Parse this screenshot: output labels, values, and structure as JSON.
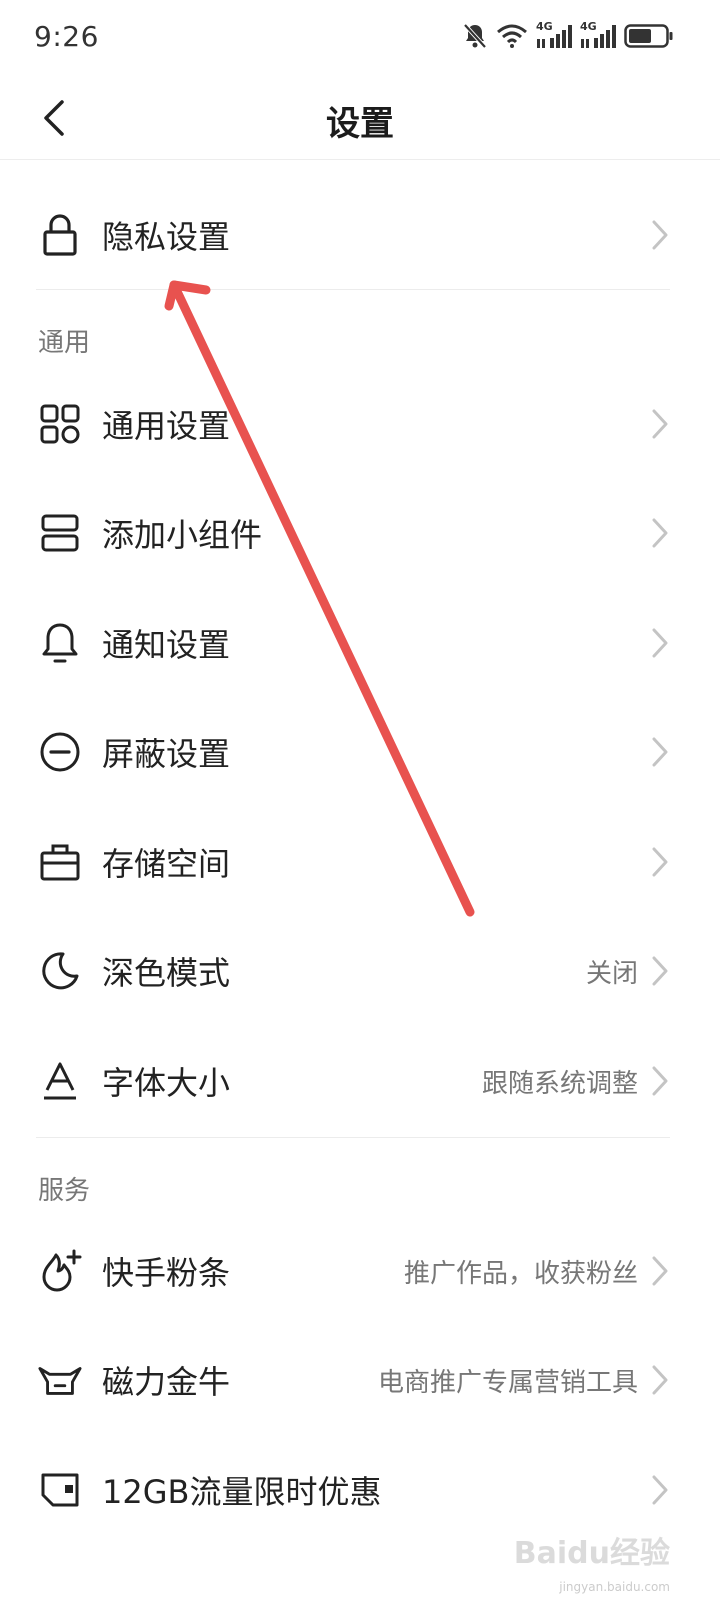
{
  "status_bar": {
    "time": "9:26",
    "net_label_1": "4G",
    "net_label_2": "4G"
  },
  "nav": {
    "title": "设置"
  },
  "privacy": {
    "label": "隐私设置",
    "icon": "lock-icon"
  },
  "general_section": {
    "header": "通用",
    "items": [
      {
        "label": "通用设置",
        "value": "",
        "icon": "grid-icon"
      },
      {
        "label": "添加小组件",
        "value": "",
        "icon": "widget-icon"
      },
      {
        "label": "通知设置",
        "value": "",
        "icon": "bell-icon"
      },
      {
        "label": "屏蔽设置",
        "value": "",
        "icon": "block-icon"
      },
      {
        "label": "存储空间",
        "value": "",
        "icon": "storage-box-icon"
      },
      {
        "label": "深色模式",
        "value": "关闭",
        "icon": "moon-icon"
      },
      {
        "label": "字体大小",
        "value": "跟随系统调整",
        "icon": "font-size-icon"
      }
    ]
  },
  "service_section": {
    "header": "服务",
    "items": [
      {
        "label": "快手粉条",
        "value": "推广作品，收获粉丝",
        "icon": "flame-plus-icon"
      },
      {
        "label": "磁力金牛",
        "value": "电商推广专属营销工具",
        "icon": "bull-icon"
      },
      {
        "label": "12GB流量限时优惠",
        "value": "",
        "icon": "sim-card-icon"
      }
    ]
  },
  "watermark": {
    "logo": "Baidu经验",
    "sub": "jingyan.baidu.com"
  },
  "colors": {
    "annotation_arrow": "#e8524f",
    "chevron": "#c4c4c4",
    "divider": "#ececec"
  }
}
